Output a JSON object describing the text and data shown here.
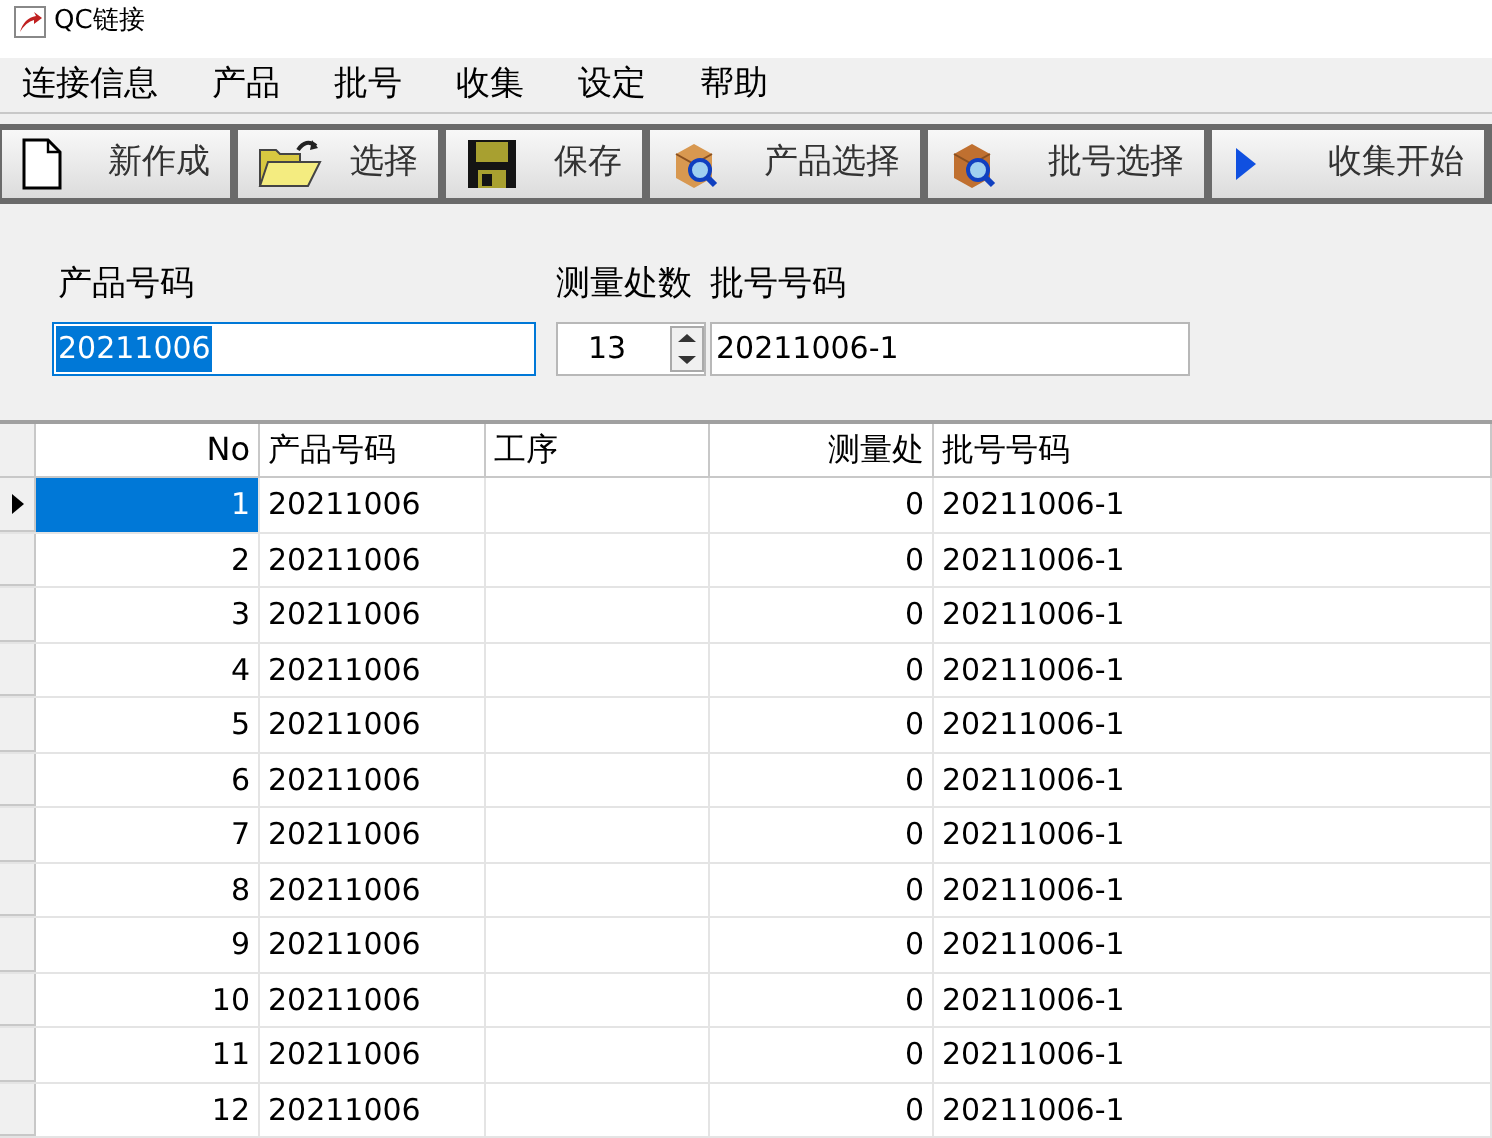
{
  "window": {
    "title": "QC链接"
  },
  "menu": [
    "连接信息",
    "产品",
    "批号",
    "收集",
    "设定",
    "帮助"
  ],
  "toolbar": [
    {
      "label": "新作成",
      "kind": "new"
    },
    {
      "label": "选择",
      "kind": "open"
    },
    {
      "label": "保存",
      "kind": "save"
    },
    {
      "label": "产品选择",
      "kind": "product"
    },
    {
      "label": "批号选择",
      "kind": "batch"
    },
    {
      "label": "收集开始",
      "kind": "start"
    }
  ],
  "form": {
    "product_label": "产品号码",
    "product_value": "20211006",
    "product_text_selected": true,
    "count_label": "测量处数",
    "count_value": "13",
    "batch_label": "批号号码",
    "batch_value": "20211006-1"
  },
  "table": {
    "columns": [
      "No",
      "产品号码",
      "工序",
      "测量处",
      "批号号码"
    ],
    "rows": [
      {
        "cells": [
          "1",
          "20211006",
          "",
          "0",
          "20211006-1"
        ],
        "selected": true
      },
      {
        "cells": [
          "2",
          "20211006",
          "",
          "0",
          "20211006-1"
        ],
        "selected": false
      },
      {
        "cells": [
          "3",
          "20211006",
          "",
          "0",
          "20211006-1"
        ],
        "selected": false
      },
      {
        "cells": [
          "4",
          "20211006",
          "",
          "0",
          "20211006-1"
        ],
        "selected": false
      },
      {
        "cells": [
          "5",
          "20211006",
          "",
          "0",
          "20211006-1"
        ],
        "selected": false
      },
      {
        "cells": [
          "6",
          "20211006",
          "",
          "0",
          "20211006-1"
        ],
        "selected": false
      },
      {
        "cells": [
          "7",
          "20211006",
          "",
          "0",
          "20211006-1"
        ],
        "selected": false
      },
      {
        "cells": [
          "8",
          "20211006",
          "",
          "0",
          "20211006-1"
        ],
        "selected": false
      },
      {
        "cells": [
          "9",
          "20211006",
          "",
          "0",
          "20211006-1"
        ],
        "selected": false
      },
      {
        "cells": [
          "10",
          "20211006",
          "",
          "0",
          "20211006-1"
        ],
        "selected": false
      },
      {
        "cells": [
          "11",
          "20211006",
          "",
          "0",
          "20211006-1"
        ],
        "selected": false
      },
      {
        "cells": [
          "12",
          "20211006",
          "",
          "0",
          "20211006-1"
        ],
        "selected": false
      }
    ]
  }
}
